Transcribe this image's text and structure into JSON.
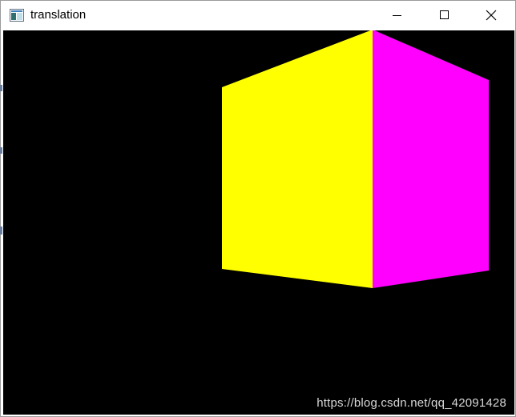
{
  "window": {
    "title": "translation",
    "icons": {
      "app": "app-window-icon",
      "minimize": "minimize-icon",
      "maximize": "maximize-icon",
      "close": "close-icon"
    }
  },
  "scene": {
    "background": "#000000",
    "faces": [
      {
        "name": "cube-face-front",
        "color": "#ffff00"
      },
      {
        "name": "cube-face-side",
        "color": "#ff00ff"
      }
    ]
  },
  "watermark": {
    "text": "https://blog.csdn.net/qq_42091428"
  }
}
